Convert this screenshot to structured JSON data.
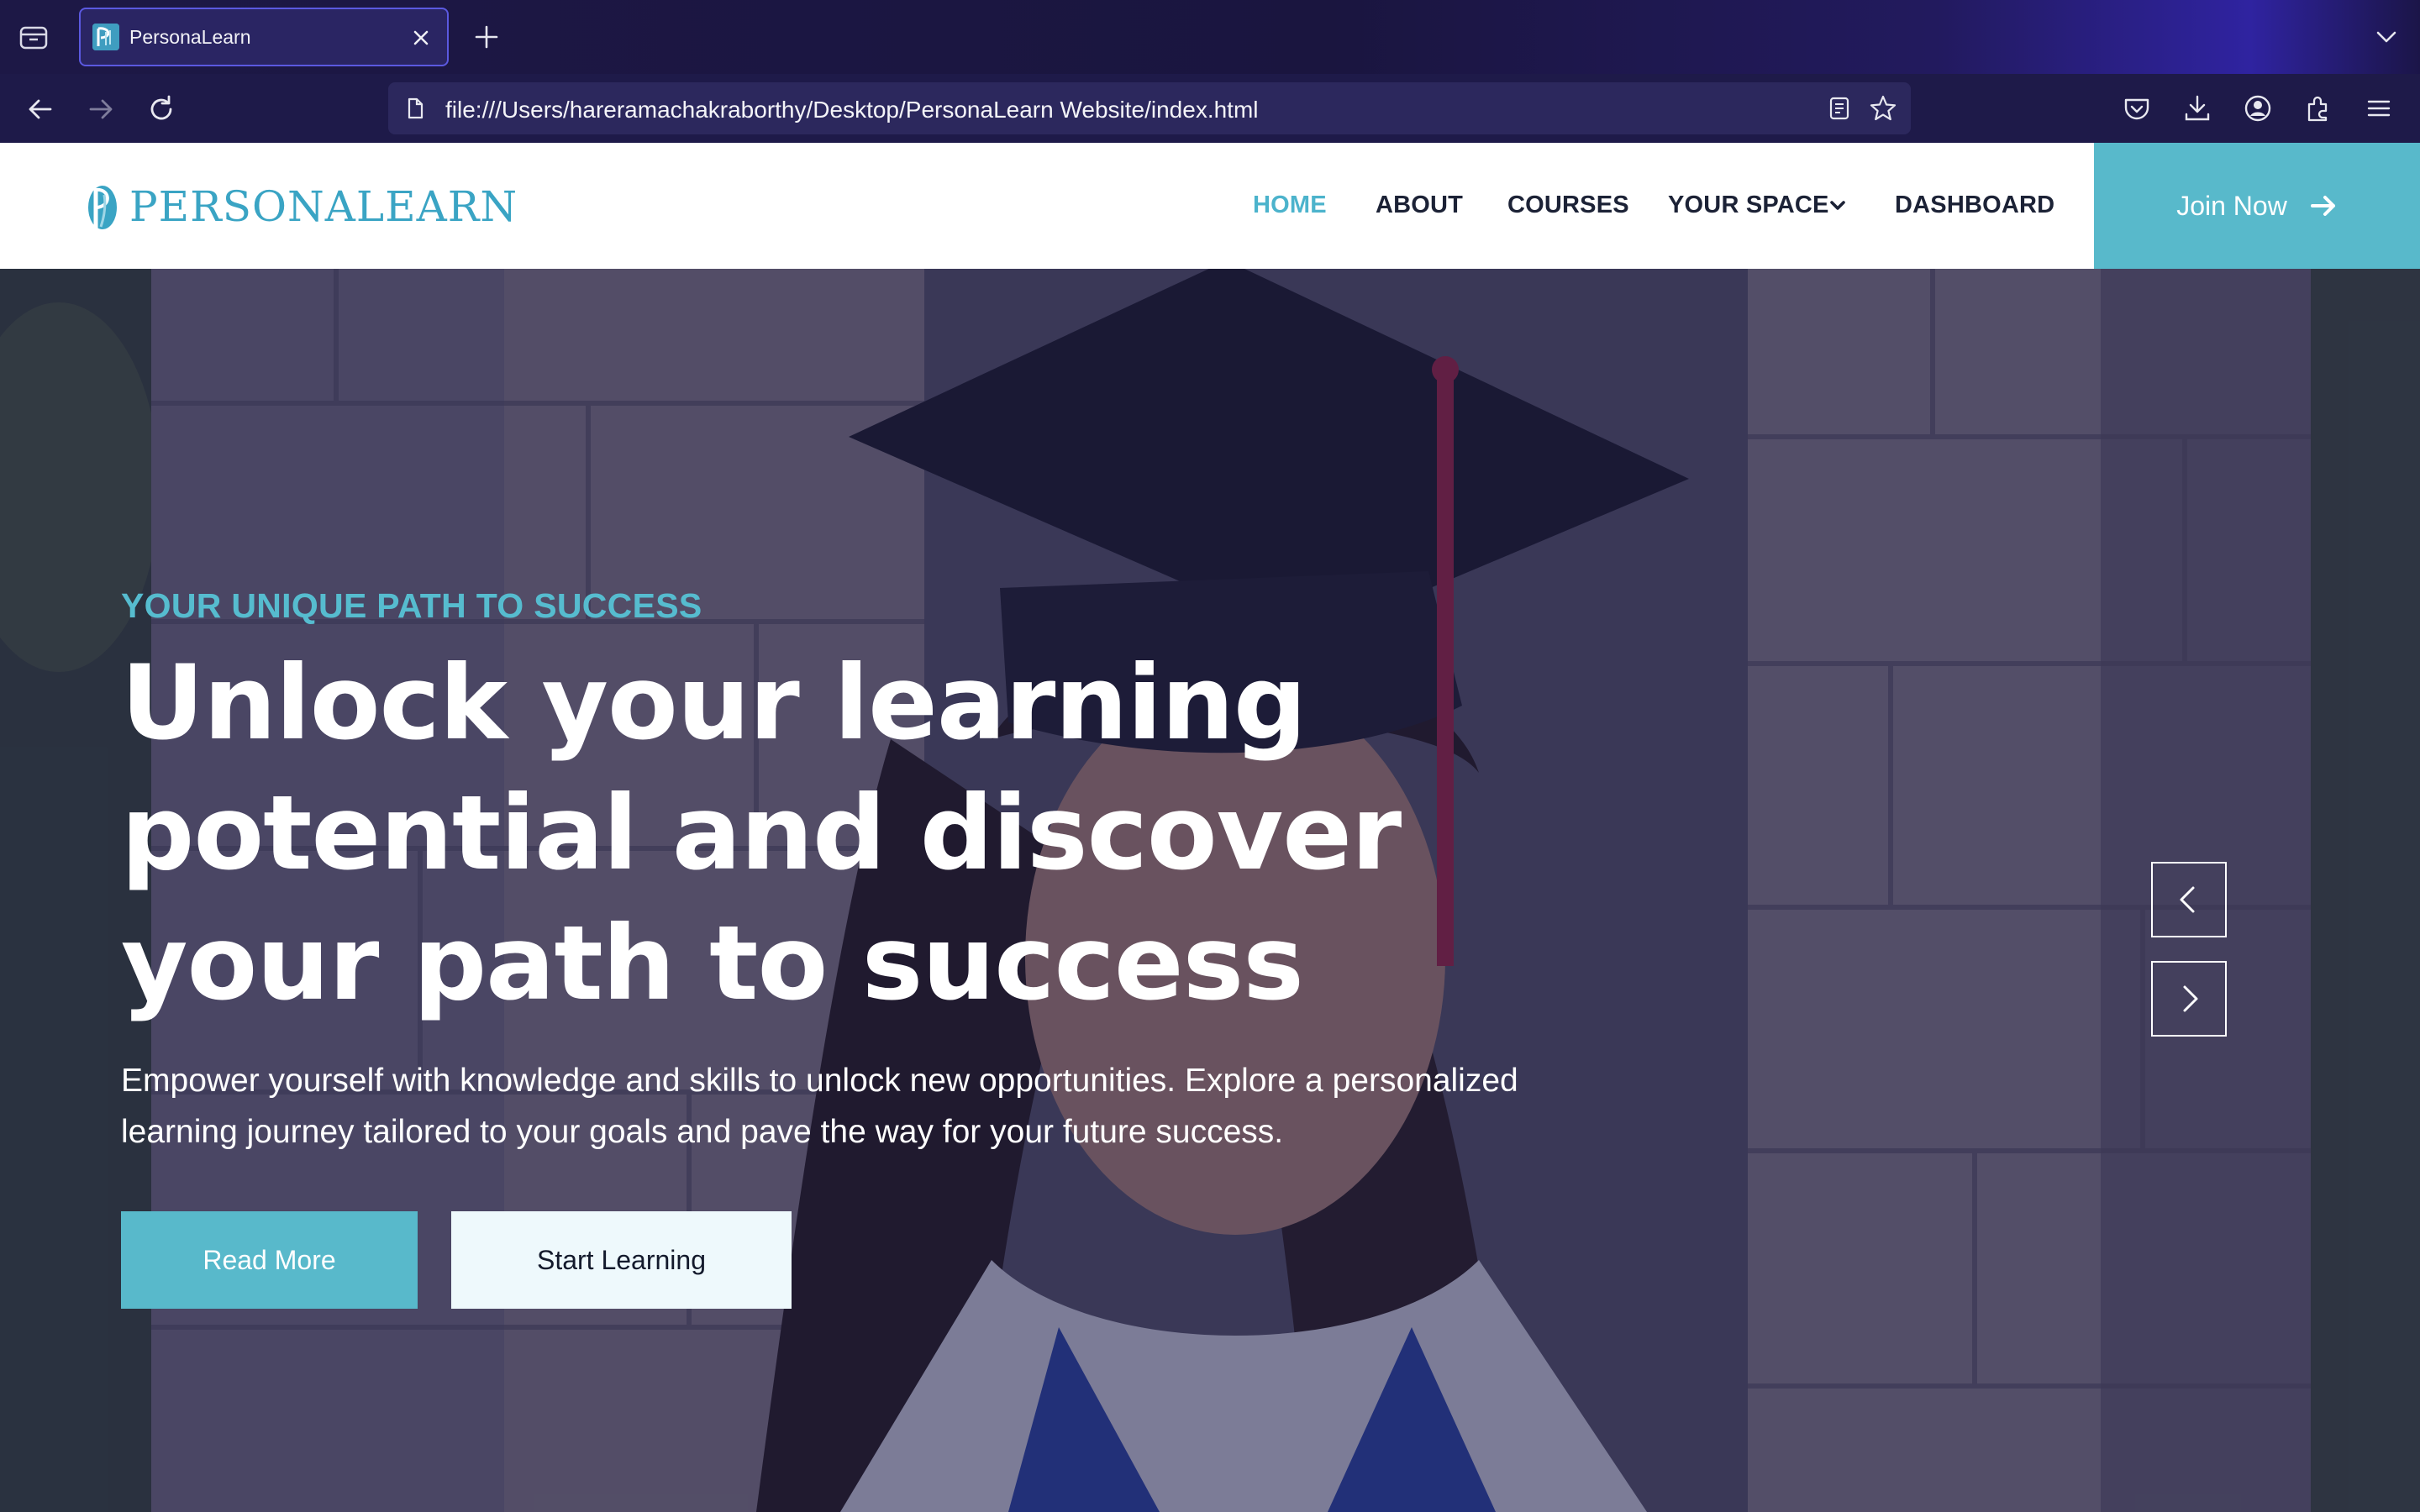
{
  "browser": {
    "tab": {
      "title": "PersonaLearn",
      "favicon_icon": "personalearn-favicon"
    },
    "url": "file:///Users/hareramachakraborthy/Desktop/PersonaLearn Website/index.html",
    "icons": {
      "tab_list": "tab-list-icon",
      "close_tab": "close-icon",
      "new_tab": "plus-icon",
      "list_all_tabs": "chevron-down-icon",
      "back": "back-arrow-icon",
      "forward": "forward-arrow-icon",
      "reload": "reload-icon",
      "page_info": "page-icon",
      "reader_view": "reader-view-icon",
      "bookmark": "star-icon",
      "pocket": "pocket-icon",
      "downloads": "download-icon",
      "account": "account-icon",
      "extensions": "extensions-icon",
      "app_menu": "hamburger-menu-icon"
    }
  },
  "site": {
    "logo_text": "PERSONALEARN",
    "nav": [
      {
        "label": "HOME",
        "active": true
      },
      {
        "label": "ABOUT",
        "active": false
      },
      {
        "label": "COURSES",
        "active": false
      },
      {
        "label": "YOUR SPACE",
        "active": false,
        "has_dropdown": true
      },
      {
        "label": "DASHBOARD",
        "active": false
      }
    ],
    "cta": {
      "label": "Join Now",
      "icon": "arrow-right-icon"
    }
  },
  "hero": {
    "eyebrow": "YOUR UNIQUE PATH TO SUCCESS",
    "headline": "Unlock your learning potential and discover your path to success",
    "subtext": "Empower yourself with knowledge and skills to unlock new opportunities. Explore a personalized learning journey tailored to your goals and pave the way for your future success.",
    "primary_button": "Read More",
    "secondary_button": "Start Learning",
    "carousel": {
      "prev_icon": "chevron-left-icon",
      "next_icon": "chevron-right-icon"
    }
  },
  "colors": {
    "browser_bg": "#1e1a49",
    "urlbar_bg": "#2c285d",
    "brand_teal": "#58b9cb",
    "nav_active": "#4cb3cc",
    "nav_text": "#1c2236",
    "hero_overlay": "#16184a"
  }
}
